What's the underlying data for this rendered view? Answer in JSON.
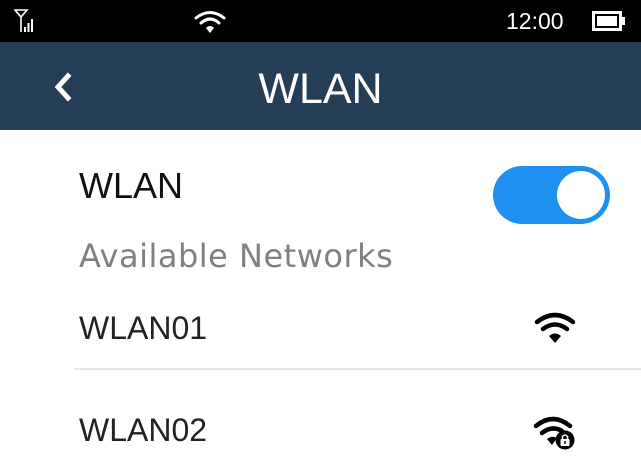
{
  "status_bar": {
    "time": "12:00",
    "icons": [
      "signal-icon",
      "wifi-icon",
      "battery-icon"
    ]
  },
  "nav": {
    "title": "WLAN",
    "back_icon": "chevron-left-icon"
  },
  "wlan_toggle": {
    "label": "WLAN",
    "state": "on"
  },
  "networks": {
    "header": "Available Networks",
    "items": [
      {
        "name": "WLAN01",
        "icon": "wifi-signal-icon",
        "secured": false
      },
      {
        "name": "WLAN02",
        "icon": "wifi-locked-icon",
        "secured": true
      }
    ]
  },
  "colors": {
    "status_bar_bg": "#000000",
    "nav_bar_bg": "#243e56",
    "toggle_on": "#1e90f0",
    "secondary_text": "#808080"
  }
}
